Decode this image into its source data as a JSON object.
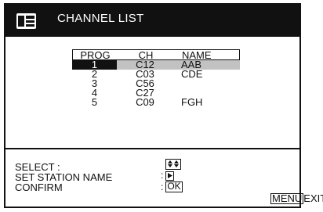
{
  "title": "CHANNEL LIST",
  "columns": {
    "prog": "PROG",
    "ch": "CH",
    "name": "NAME"
  },
  "rows": [
    {
      "prog": "1",
      "ch": "C12",
      "name": "AAB",
      "selected": true
    },
    {
      "prog": "2",
      "ch": "C03",
      "name": "CDE"
    },
    {
      "prog": "3",
      "ch": "C56",
      "name": ""
    },
    {
      "prog": "4",
      "ch": "C27",
      "name": ""
    },
    {
      "prog": "5",
      "ch": "C09",
      "name": "FGH"
    }
  ],
  "help": {
    "select": "SELECT :",
    "set_station_name": "SET STATION NAME",
    "confirm": "CONFIRM",
    "colon": ":",
    "ok_key": "OK"
  },
  "footer": {
    "menu_key": "MENU",
    "exit": "EXIT :"
  },
  "colors": {
    "ink": "#111111",
    "highlight": "#c2c2c2",
    "paper": "#ffffff"
  },
  "icons": [
    "list-panel-icon",
    "up-down-arrows-icon",
    "right-arrow-icon"
  ]
}
